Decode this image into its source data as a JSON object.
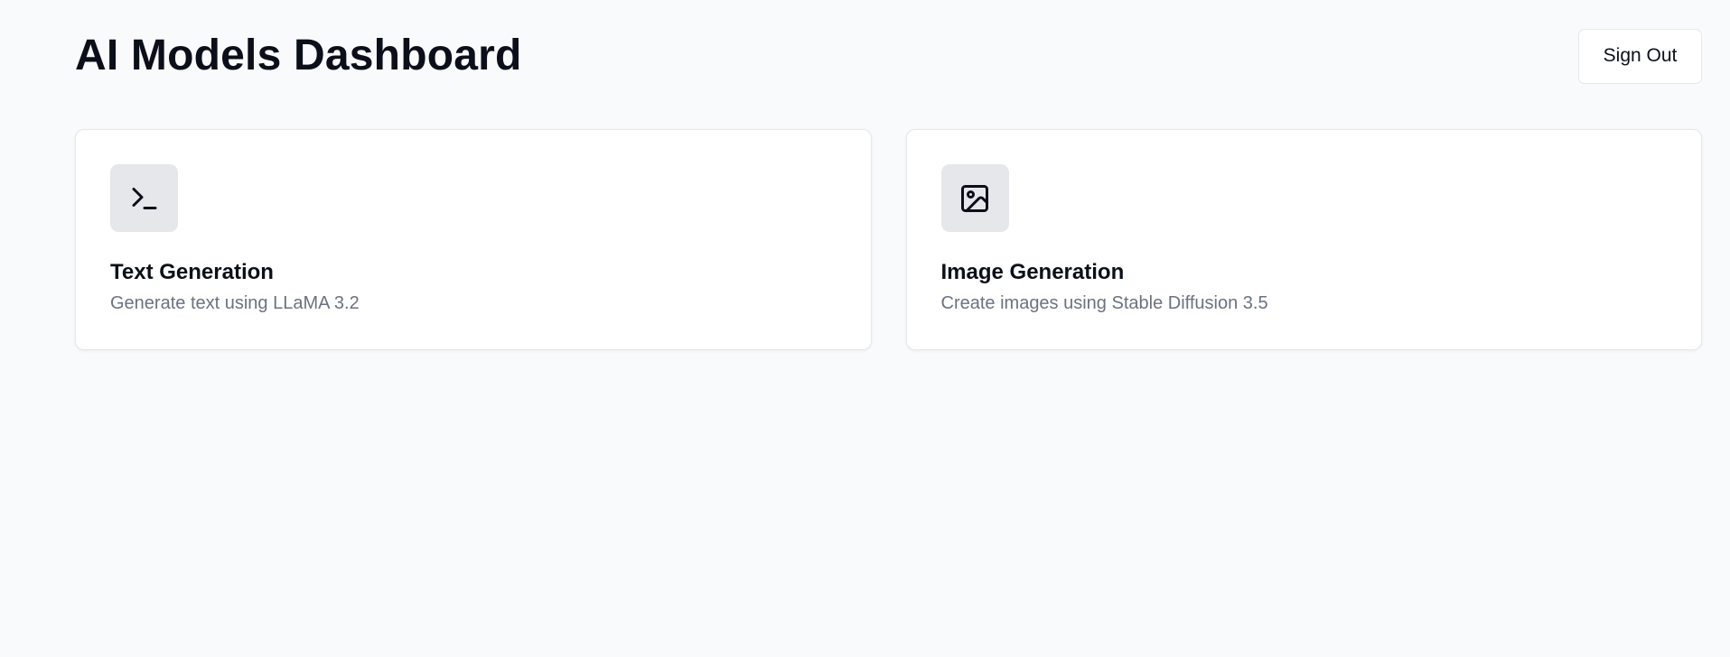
{
  "header": {
    "title": "AI Models Dashboard",
    "sign_out_label": "Sign Out"
  },
  "cards": [
    {
      "icon": "terminal-icon",
      "title": "Text Generation",
      "description": "Generate text using LLaMA 3.2"
    },
    {
      "icon": "image-icon",
      "title": "Image Generation",
      "description": "Create images using Stable Diffusion 3.5"
    }
  ],
  "colors": {
    "background": "#f9fafb",
    "card_background": "#ffffff",
    "icon_tile": "#e5e7eb",
    "text_primary": "#0b0f19",
    "text_secondary": "#6b7280",
    "border": "#e5e7eb"
  }
}
